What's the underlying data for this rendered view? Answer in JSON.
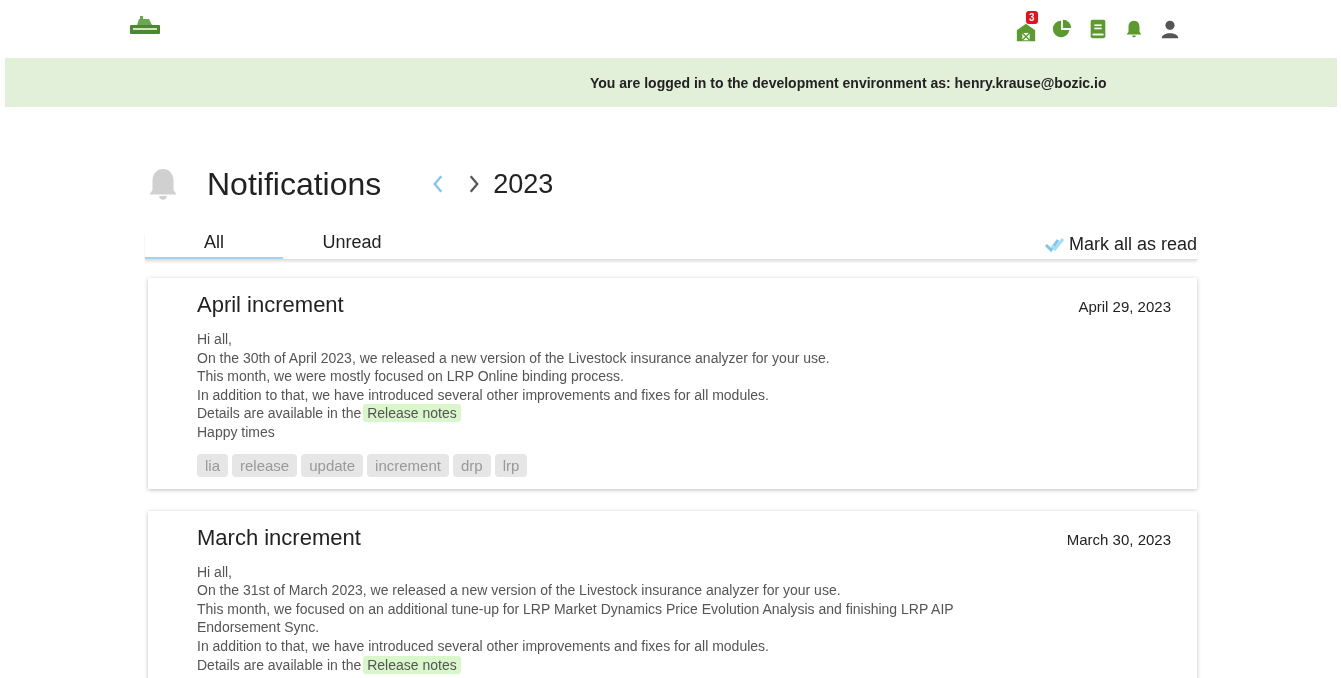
{
  "header": {
    "badge": "3"
  },
  "banner": {
    "text": "You are logged in to the development environment as: henry.krause@bozic.io"
  },
  "page": {
    "title": "Notifications",
    "year": "2023"
  },
  "tabs": [
    {
      "label": "All",
      "selected": true
    },
    {
      "label": "Unread",
      "selected": false
    }
  ],
  "mark_all": {
    "label": "Mark all as read"
  },
  "notifications": [
    {
      "title": "April increment",
      "date": "April 29, 2023",
      "lines": [
        {
          "kind": "text",
          "text": "Hi all,"
        },
        {
          "kind": "text",
          "text": "On the 30th of April 2023, we released a new version of the Livestock insurance analyzer for your use."
        },
        {
          "kind": "text",
          "text": "This month, we were mostly focused on LRP Online binding process."
        },
        {
          "kind": "text",
          "text": "In addition to that, we have introduced several other improvements and fixes for all modules."
        },
        {
          "kind": "link",
          "text": "Details are available in the",
          "link": "Release notes"
        },
        {
          "kind": "text",
          "text": "Happy times"
        }
      ],
      "tags": [
        "lia",
        "release",
        "update",
        "increment",
        "drp",
        "lrp"
      ]
    },
    {
      "title": "March increment",
      "date": "March 30, 2023",
      "lines": [
        {
          "kind": "text",
          "text": "Hi all,"
        },
        {
          "kind": "text",
          "text": "On the 31st of March 2023, we released a new version of the Livestock insurance analyzer for your use."
        },
        {
          "kind": "text",
          "text": "This month, we focused on an additional tune-up for LRP Market Dynamics Price Evolution Analysis and finishing LRP AIP Endorsement Sync."
        },
        {
          "kind": "text",
          "text": "In addition to that, we have introduced several other improvements and fixes for all modules."
        },
        {
          "kind": "link",
          "text": "Details are available in the",
          "link": "Release notes"
        }
      ]
    }
  ]
}
